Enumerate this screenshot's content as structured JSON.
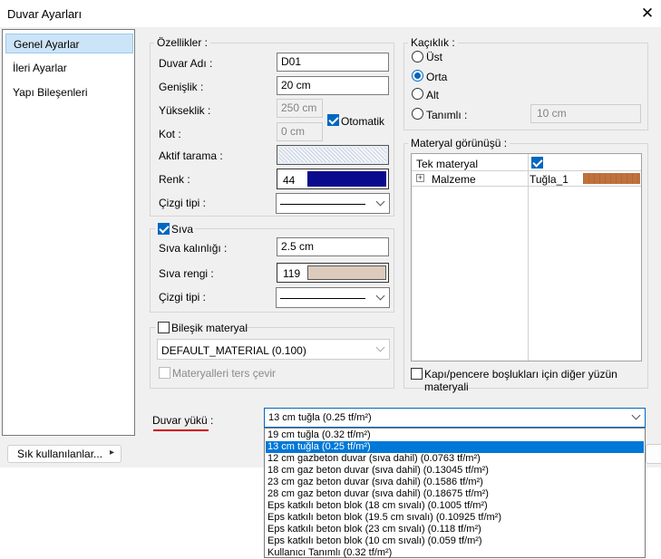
{
  "window": {
    "title": "Duvar Ayarları"
  },
  "sidebar": {
    "items": [
      {
        "label": "Genel Ayarlar"
      },
      {
        "label": "İleri Ayarlar"
      },
      {
        "label": "Yapı Bileşenleri"
      }
    ]
  },
  "ozellikler": {
    "group_label": "Özellikler :",
    "duvar_adi": {
      "label": "Duvar Adı :",
      "value": "D01"
    },
    "genislik": {
      "label": "Genişlik :",
      "value": "20 cm"
    },
    "yukseklik": {
      "label": "Yükseklik :",
      "value": "250 cm"
    },
    "otomatik": {
      "label": "Otomatik",
      "checked": true
    },
    "kot": {
      "label": "Kot :",
      "value": "0 cm"
    },
    "aktif_tarama": {
      "label": "Aktif tarama :"
    },
    "renk": {
      "label": "Renk :",
      "value": "44",
      "color": "#0a0a8c"
    },
    "cizgi_tipi": {
      "label": "Çizgi tipi :"
    }
  },
  "siva": {
    "label": "Sıva",
    "checked": true,
    "kalinlik": {
      "label": "Sıva kalınlığı :",
      "value": "2.5 cm"
    },
    "renk": {
      "label": "Sıva rengi :",
      "value": "119",
      "color": "#dccbbd"
    },
    "cizgi_tipi": {
      "label": "Çizgi tipi :"
    }
  },
  "bilesik": {
    "label": "Bileşik materyal",
    "checked": false,
    "material": "DEFAULT_MATERIAL (0.100)",
    "ters_cevir": "Materyalleri ters çevir"
  },
  "kaciklik": {
    "group_label": "Kaçıklık :",
    "options": [
      {
        "label": "Üst"
      },
      {
        "label": "Orta"
      },
      {
        "label": "Alt"
      },
      {
        "label": "Tanımlı :"
      }
    ],
    "selected": "Orta",
    "tanimli_value": "10 cm"
  },
  "materyal": {
    "group_label": "Materyal görünüşü :",
    "tek_materyal": {
      "label": "Tek materyal",
      "checked": true
    },
    "malzeme": {
      "expand": "+",
      "label": "Malzeme",
      "value": "Tuğla_1",
      "color": "#c0723c"
    },
    "kapi_pencere": {
      "label": "Kapı/pencere boşlukları için diğer yüzün materyali",
      "checked": false
    }
  },
  "duvar_yuku": {
    "label": "Duvar yükü :",
    "selected": "13 cm tuğla (0.25 tf/m²)",
    "options": [
      "19 cm tuğla (0.32 tf/m²)",
      "13 cm tuğla (0.25 tf/m²)",
      "12 cm gazbeton duvar (sıva dahil) (0.0763 tf/m²)",
      "18 cm gaz beton duvar (sıva dahil) (0.13045 tf/m²)",
      "23 cm gaz beton duvar (sıva dahil) (0.1586 tf/m²)",
      "28 cm gaz beton duvar (sıva dahil) (0.18675 tf/m²)",
      "Eps katkılı beton blok (18 cm sıvalı) (0.1005 tf/m²)",
      "Eps katkılı beton blok (19.5 cm sıvalı) (0.10925 tf/m²)",
      "Eps katkılı beton blok (23 cm sıvalı) (0.118 tf/m²)",
      "Eps katkılı beton blok (10 cm sıvalı) (0.059 tf/m²)",
      "Kullanıcı Tanımlı (0.32 tf/m²)"
    ],
    "highlight_index": 1,
    "underline_color": "#d00000"
  },
  "footer": {
    "sik_kullanilanlar": "Sık kullanılanlar...",
    "arrow": "▸"
  },
  "colors": {
    "accent": "#0067c0",
    "highlight": "#0078d7"
  }
}
